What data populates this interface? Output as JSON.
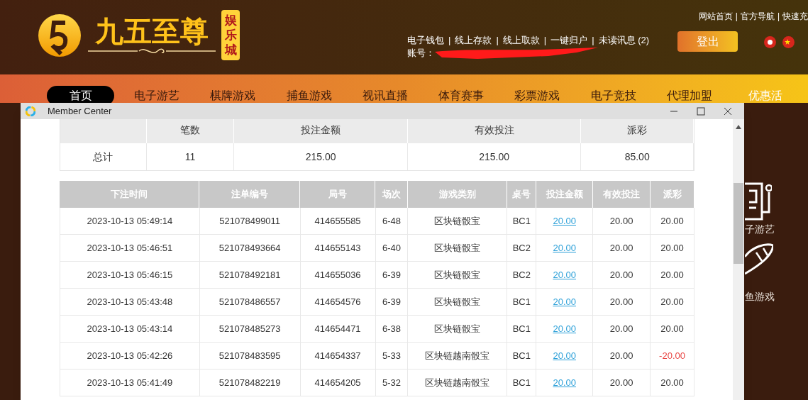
{
  "site": {
    "logo_title": "九五至尊",
    "logo_badge": "娱乐城"
  },
  "top_links": [
    "网站首页",
    "官方导航",
    "快速充"
  ],
  "account_links": [
    "电子钱包",
    "线上存款",
    "线上取款",
    "一键归户",
    "未读讯息 (2)"
  ],
  "account_label": "账号：",
  "logout_button": "登出",
  "nav": [
    {
      "label": "首页",
      "selected": true
    },
    {
      "label": "电子游艺",
      "selected": false
    },
    {
      "label": "棋牌游戏",
      "selected": false
    },
    {
      "label": "捕鱼游戏",
      "selected": false
    },
    {
      "label": "视讯直播",
      "selected": false
    },
    {
      "label": "体育赛事",
      "selected": false
    },
    {
      "label": "彩票游戏",
      "selected": false
    },
    {
      "label": "电子竞技",
      "selected": false
    },
    {
      "label": "代理加盟",
      "selected": false
    },
    {
      "label": "优惠活",
      "selected": false
    }
  ],
  "side_menu": [
    "子游艺",
    "鱼游戏"
  ],
  "separator": "|",
  "window": {
    "title": "Member Center"
  },
  "summary": {
    "columns": [
      "",
      "笔数",
      "投注金额",
      "有效投注",
      "派彩"
    ],
    "row": [
      "总计",
      "11",
      "215.00",
      "215.00",
      "85.00"
    ]
  },
  "bets": {
    "columns": [
      "下注时间",
      "注单编号",
      "局号",
      "场次",
      "游戏类别",
      "桌号",
      "投注金额",
      "有效投注",
      "派彩"
    ],
    "rows": [
      {
        "time": "2023-10-13 05:49:14",
        "order": "521078499011",
        "round": "414655585",
        "session": "6-48",
        "game": "区块链骰宝",
        "table": "BC1",
        "amount": "20.00",
        "valid": "20.00",
        "payout": "20.00",
        "loss": false
      },
      {
        "time": "2023-10-13 05:46:51",
        "order": "521078493664",
        "round": "414655143",
        "session": "6-40",
        "game": "区块链骰宝",
        "table": "BC2",
        "amount": "20.00",
        "valid": "20.00",
        "payout": "20.00",
        "loss": false
      },
      {
        "time": "2023-10-13 05:46:15",
        "order": "521078492181",
        "round": "414655036",
        "session": "6-39",
        "game": "区块链骰宝",
        "table": "BC2",
        "amount": "20.00",
        "valid": "20.00",
        "payout": "20.00",
        "loss": false
      },
      {
        "time": "2023-10-13 05:43:48",
        "order": "521078486557",
        "round": "414654576",
        "session": "6-39",
        "game": "区块链骰宝",
        "table": "BC1",
        "amount": "20.00",
        "valid": "20.00",
        "payout": "20.00",
        "loss": false
      },
      {
        "time": "2023-10-13 05:43:14",
        "order": "521078485273",
        "round": "414654471",
        "session": "6-38",
        "game": "区块链骰宝",
        "table": "BC1",
        "amount": "20.00",
        "valid": "20.00",
        "payout": "20.00",
        "loss": false
      },
      {
        "time": "2023-10-13 05:42:26",
        "order": "521078483595",
        "round": "414654337",
        "session": "5-33",
        "game": "区块链越南骰宝",
        "table": "BC1",
        "amount": "20.00",
        "valid": "20.00",
        "payout": "-20.00",
        "loss": true
      },
      {
        "time": "2023-10-13 05:41:49",
        "order": "521078482219",
        "round": "414654205",
        "session": "5-32",
        "game": "区块链越南骰宝",
        "table": "BC1",
        "amount": "20.00",
        "valid": "20.00",
        "payout": "20.00",
        "loss": false
      }
    ]
  }
}
